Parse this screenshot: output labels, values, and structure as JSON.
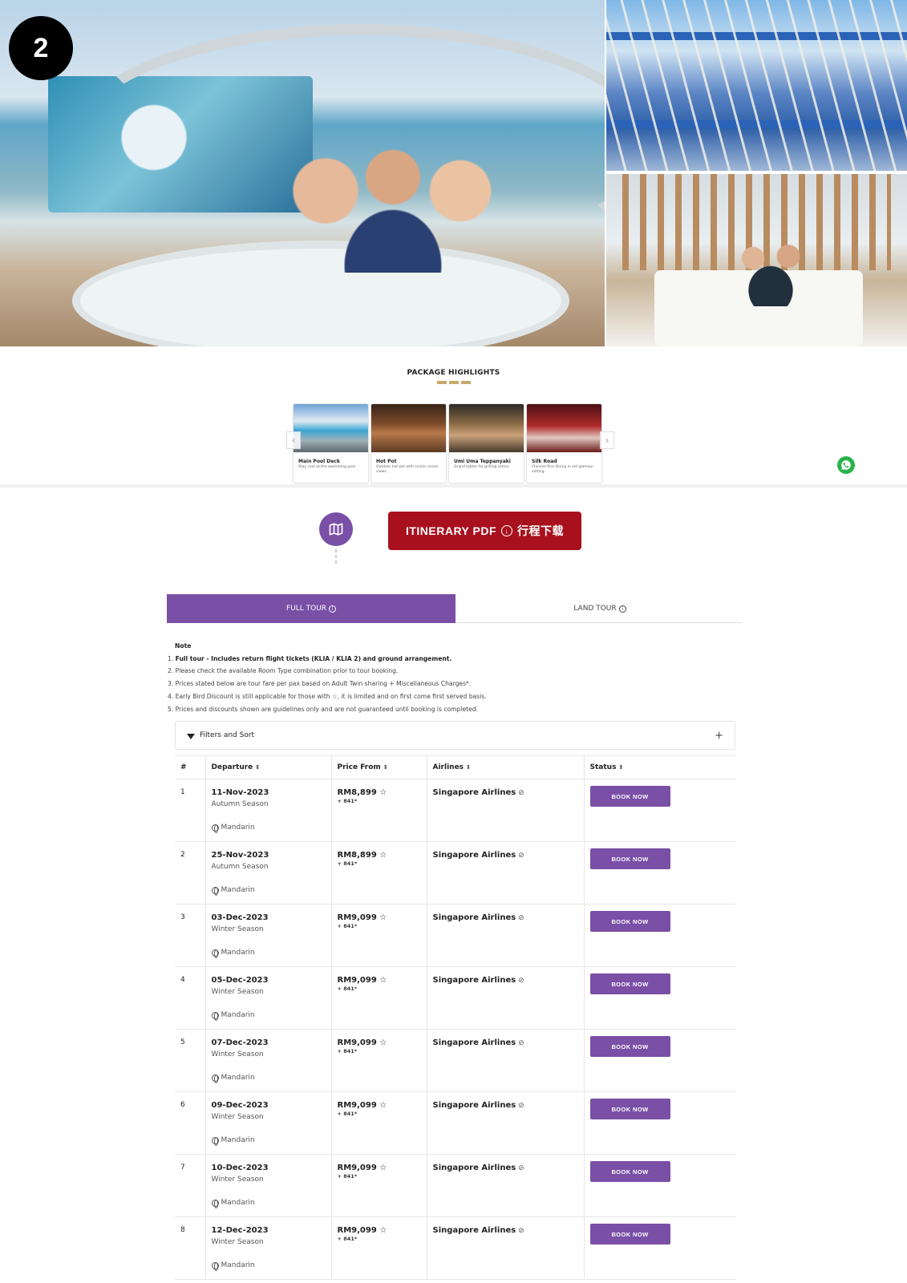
{
  "page_badge": "2",
  "highlights": {
    "title": "PACKAGE HIGHLIGHTS",
    "cards": [
      {
        "title": "Main Pool Deck",
        "desc": "Stay cool at the swimming pool"
      },
      {
        "title": "Hot Pot",
        "desc": "Outdoor hot pot with scenic ocean views"
      },
      {
        "title": "Umi Uma Teppanyaki",
        "desc": "Grand tables for grilling action"
      },
      {
        "title": "Silk Road",
        "desc": "Chinese fine dining in old glamour setting"
      }
    ]
  },
  "itinerary": {
    "pdf_label": "ITINERARY PDF",
    "pdf_label_cn": "行程下载"
  },
  "tabs": {
    "full": "FULL TOUR",
    "land": "LAND TOUR"
  },
  "notes": {
    "heading": "Note",
    "item1_bold": "Full tour - Includes return flight tickets (KLIA / KLIA 2) and ground arrangement.",
    "item2": "Please check the available Room Type combination prior to tour booking.",
    "item3": "Prices stated below are tour fare per pax based on Adult Twin sharing + Miscellaneous Charges*.",
    "item4": "Early Bird Discount is still applicable for those with ☆, it is limited and on first come first served basis.",
    "item5": "Prices and discounts shown are guidelines only and are not guaranteed until booking is completed."
  },
  "filters": {
    "label": "Filters and Sort",
    "toggle": "+"
  },
  "table": {
    "headers": {
      "num": "#",
      "departure": "Departure",
      "price": "Price From",
      "airlines": "Airlines",
      "status": "Status"
    },
    "book_label": "BOOK NOW",
    "rows": [
      {
        "num": "1",
        "date": "11-Nov-2023",
        "season": "Autumn Season",
        "lang": "Mandarin",
        "price": "RM8,899",
        "surcharge": "+ 841*",
        "airline": "Singapore Airlines"
      },
      {
        "num": "2",
        "date": "25-Nov-2023",
        "season": "Autumn Season",
        "lang": "Mandarin",
        "price": "RM8,899",
        "surcharge": "+ 841*",
        "airline": "Singapore Airlines"
      },
      {
        "num": "3",
        "date": "03-Dec-2023",
        "season": "Winter Season",
        "lang": "Mandarin",
        "price": "RM9,099",
        "surcharge": "+ 841*",
        "airline": "Singapore Airlines"
      },
      {
        "num": "4",
        "date": "05-Dec-2023",
        "season": "Winter Season",
        "lang": "Mandarin",
        "price": "RM9,099",
        "surcharge": "+ 841*",
        "airline": "Singapore Airlines"
      },
      {
        "num": "5",
        "date": "07-Dec-2023",
        "season": "Winter Season",
        "lang": "Mandarin",
        "price": "RM9,099",
        "surcharge": "+ 841*",
        "airline": "Singapore Airlines"
      },
      {
        "num": "6",
        "date": "09-Dec-2023",
        "season": "Winter Season",
        "lang": "Mandarin",
        "price": "RM9,099",
        "surcharge": "+ 841*",
        "airline": "Singapore Airlines"
      },
      {
        "num": "7",
        "date": "10-Dec-2023",
        "season": "Winter Season",
        "lang": "Mandarin",
        "price": "RM9,099",
        "surcharge": "+ 841*",
        "airline": "Singapore Airlines"
      },
      {
        "num": "8",
        "date": "12-Dec-2023",
        "season": "Winter Season",
        "lang": "Mandarin",
        "price": "RM9,099",
        "surcharge": "+ 841*",
        "airline": "Singapore Airlines"
      }
    ]
  },
  "colors": {
    "purple": "#7a4fa6",
    "pdf_red": "#a8101e",
    "gold": "#c9a96a",
    "whatsapp": "#29b34a"
  }
}
